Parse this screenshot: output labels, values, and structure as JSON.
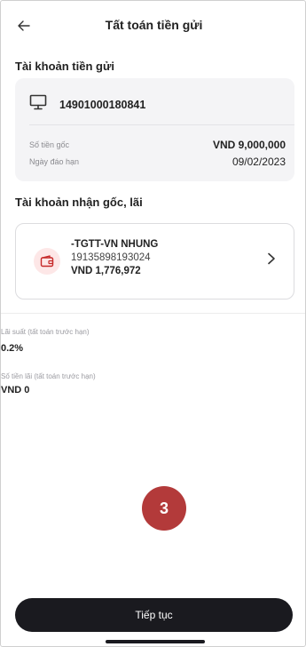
{
  "header": {
    "title": "Tất toán tiền gửi"
  },
  "deposit_section": {
    "title": "Tài khoản tiền gửi",
    "account_number": "14901000180841",
    "principal_label": "Số tiền gốc",
    "principal_value": "VND 9,000,000",
    "maturity_label": "Ngày đáo hạn",
    "maturity_value": "09/02/2023"
  },
  "receive_section": {
    "title": "Tài khoản nhận gốc, lãi",
    "account_name": "-TGTT-VN NHUNG",
    "account_number": "19135898193024",
    "balance": "VND 1,776,972"
  },
  "interest": {
    "rate_label": "Lãi suất (tất toán trước hạn)",
    "rate_value": "0.2%",
    "amount_label": "Số tiền lãi (tất toán trước hạn)",
    "amount_value": "VND 0"
  },
  "step_badge": "3",
  "continue_button": "Tiếp tục",
  "colors": {
    "accent": "#b33a3a",
    "button": "#1a1a1f",
    "card": "#f4f4f6"
  },
  "icons": [
    "back-arrow-icon",
    "monitor-icon",
    "wallet-icon",
    "chevron-right-icon"
  ]
}
